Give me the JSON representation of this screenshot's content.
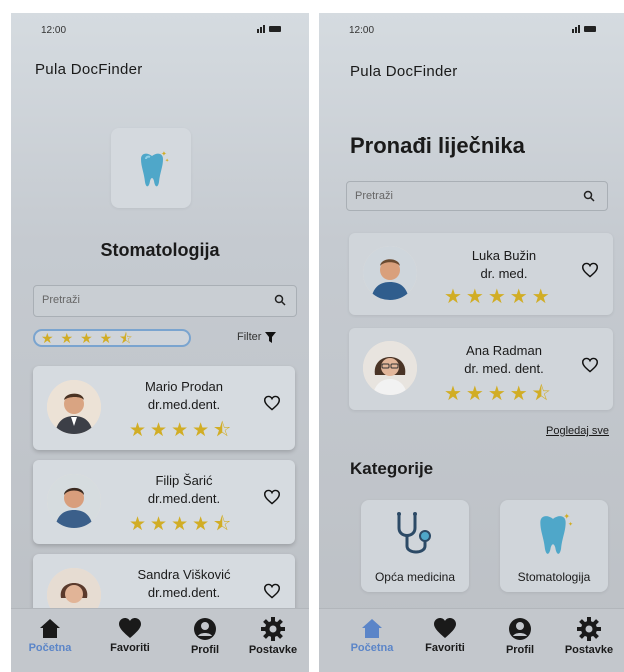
{
  "left": {
    "status": {
      "time": "12:00"
    },
    "app_title": "Pula DocFinder",
    "category_title": "Stomatologija",
    "search_placeholder": "Pretraži",
    "rating_filter": "★★★★⯪",
    "filter_label": "Filter",
    "doctors": [
      {
        "name": "Mario Prodan",
        "title": "dr.med.dent.",
        "stars": "★★★★⯪",
        "rating": 4.5
      },
      {
        "name": "Filip Šarić",
        "title": "dr.med.dent.",
        "stars": "★★★★⯪",
        "rating": 4.5
      },
      {
        "name": "Sandra Višković",
        "title": "dr.med.dent.",
        "stars": "",
        "rating": null
      }
    ],
    "nav": [
      {
        "label": "Početna",
        "icon": "home-icon",
        "active": true
      },
      {
        "label": "Favoriti",
        "icon": "heart-icon"
      },
      {
        "label": "Profil",
        "icon": "user-icon"
      },
      {
        "label": "Postavke",
        "icon": "gear-icon"
      }
    ]
  },
  "right": {
    "status": {
      "time": "12:00"
    },
    "app_title": "Pula DocFinder",
    "page_title": "Pronađi liječnika",
    "search_placeholder": "Pretraži",
    "doctors": [
      {
        "name": "Luka Bužin",
        "title": "dr. med.",
        "stars": "★★★★★",
        "rating": 5
      },
      {
        "name": "Ana Radman",
        "title": "dr. med. dent.",
        "stars": "★★★★⯪",
        "rating": 4.5
      }
    ],
    "see_all": "Pogledaj sve",
    "categories_heading": "Kategorije",
    "categories": [
      {
        "label": "Opća medicina",
        "icon": "stethoscope-icon"
      },
      {
        "label": "Stomatologija",
        "icon": "tooth-icon"
      }
    ],
    "nav": [
      {
        "label": "Početna",
        "icon": "home-icon",
        "active": true
      },
      {
        "label": "Favoriti",
        "icon": "heart-icon"
      },
      {
        "label": "Profil",
        "icon": "user-icon"
      },
      {
        "label": "Postavke",
        "icon": "gear-icon"
      }
    ]
  },
  "colors": {
    "accent": "#5b85c8",
    "star": "#d1ad25",
    "tooth": "#4fa7c9"
  }
}
